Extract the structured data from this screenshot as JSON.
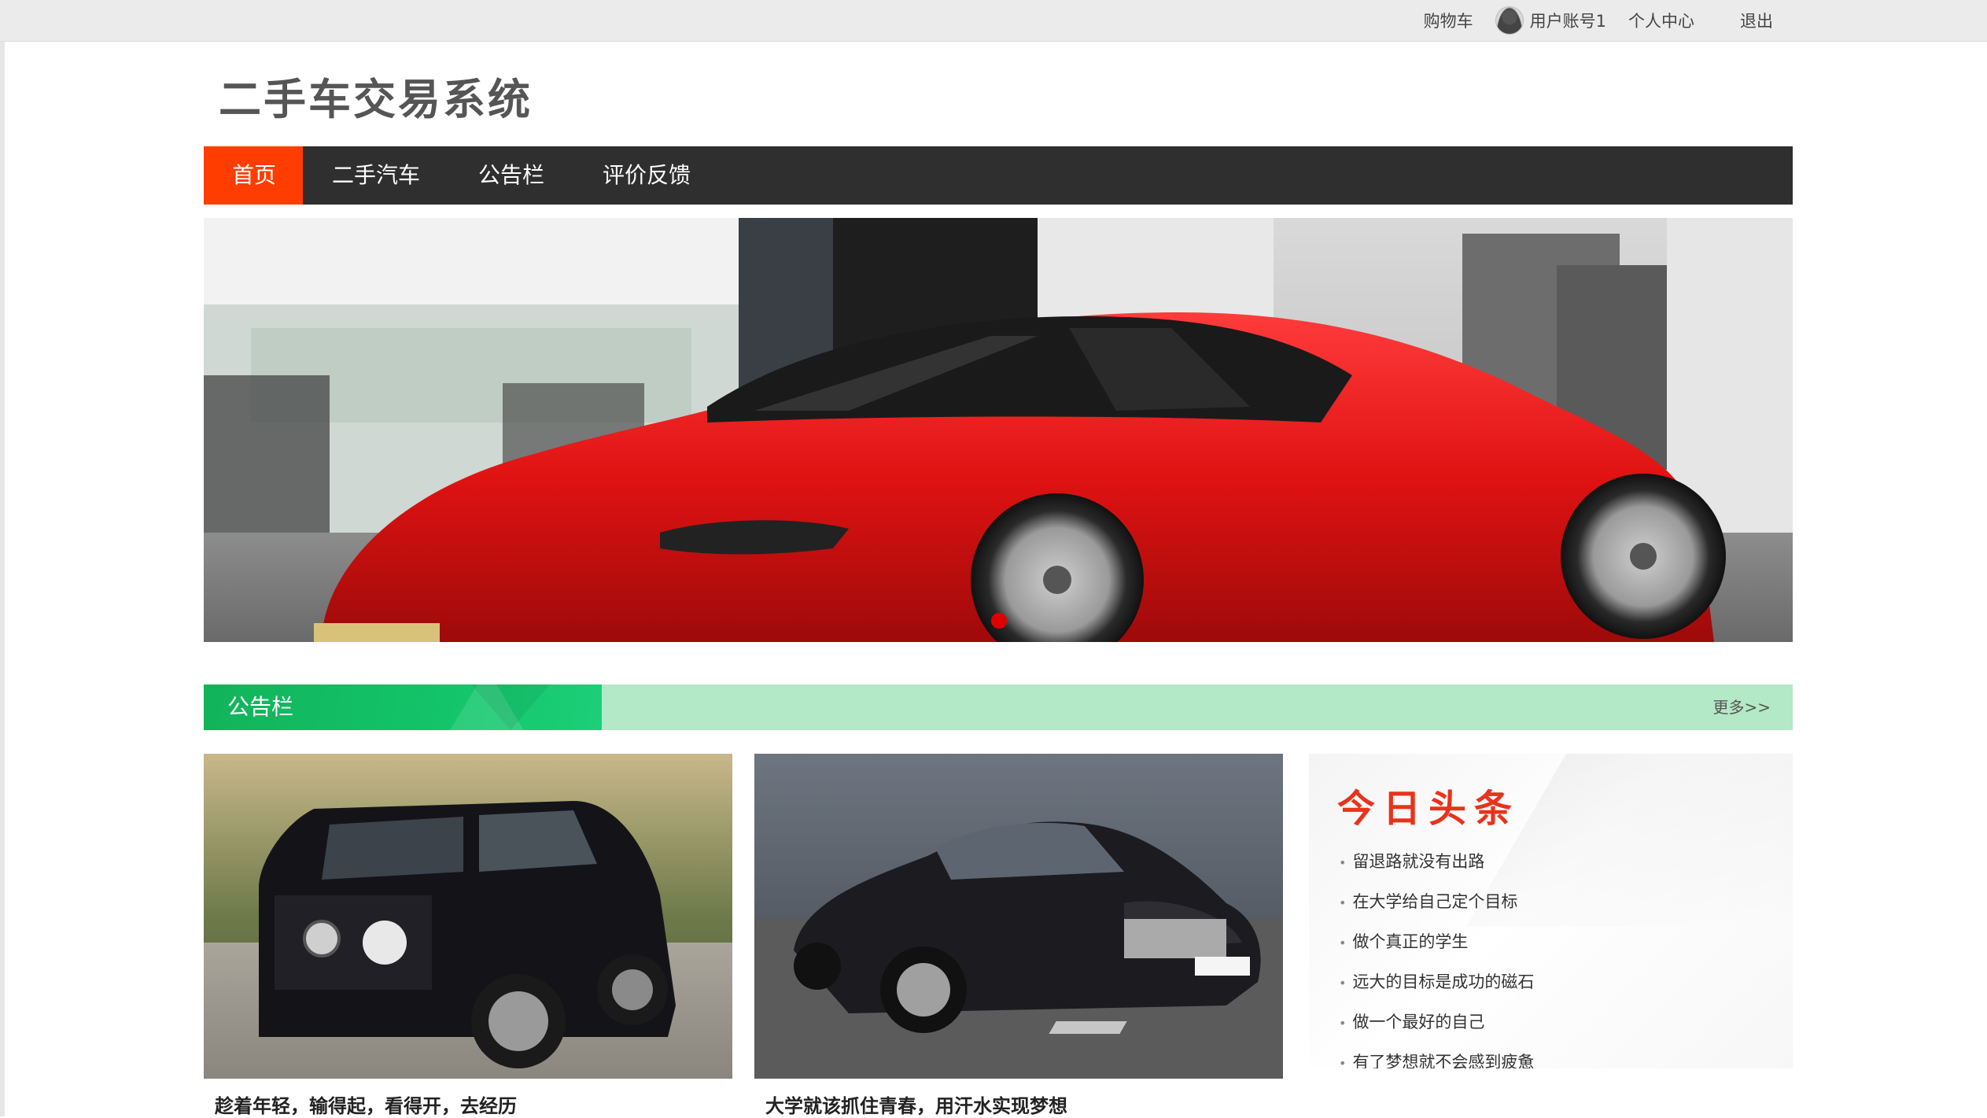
{
  "topbar": {
    "cart": "购物车",
    "username": "用户账号1",
    "profile": "个人中心",
    "logout": "退出"
  },
  "site": {
    "title": "二手车交易系统"
  },
  "nav": {
    "items": [
      {
        "label": "首页",
        "active": true
      },
      {
        "label": "二手汽车",
        "active": false
      },
      {
        "label": "公告栏",
        "active": false
      },
      {
        "label": "评价反馈",
        "active": false
      }
    ]
  },
  "banner": {
    "dots": 1,
    "active_dot_color": "#e00000"
  },
  "notice_section": {
    "title": "公告栏",
    "more": "更多>>"
  },
  "cards": [
    {
      "caption": "趁着年轻，输得起，看得开，去经历"
    },
    {
      "caption": "大学就该抓住青春，用汗水实现梦想"
    }
  ],
  "headline": {
    "title": "今日头条",
    "items": [
      "留退路就没有出路",
      "在大学给自己定个目标",
      "做个真正的学生",
      "远大的目标是成功的磁石",
      "做一个最好的自己",
      "有了梦想就不会感到疲惫"
    ]
  },
  "colors": {
    "nav_bg": "#2f2f2f",
    "nav_active": "#ff3d00",
    "section_green": "#13c46a",
    "section_light_green": "#b3e9c6",
    "headline_red": "#e8331c"
  }
}
